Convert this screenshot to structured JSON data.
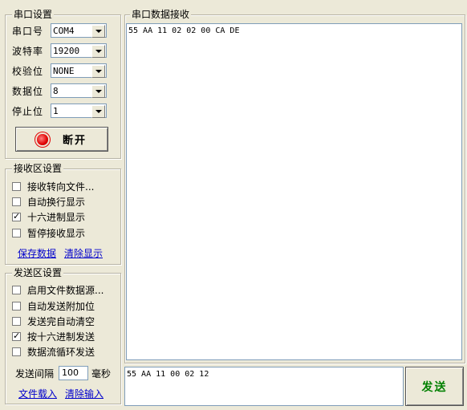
{
  "serial_settings": {
    "title": "串口设置",
    "port_label": "串口号",
    "port_value": "COM4",
    "baud_label": "波特率",
    "baud_value": "19200",
    "parity_label": "校验位",
    "parity_value": "NONE",
    "databits_label": "数据位",
    "databits_value": "8",
    "stopbits_label": "停止位",
    "stopbits_value": "1",
    "connect_button": "断开",
    "status_color": "#E00000"
  },
  "receive_settings": {
    "title": "接收区设置",
    "options": [
      {
        "label": "接收转向文件...",
        "checked": false
      },
      {
        "label": "自动换行显示",
        "checked": false
      },
      {
        "label": "十六进制显示",
        "checked": true
      },
      {
        "label": "暂停接收显示",
        "checked": false
      }
    ],
    "save_link": "保存数据",
    "clear_link": "清除显示"
  },
  "send_settings": {
    "title": "发送区设置",
    "options": [
      {
        "label": "启用文件数据源...",
        "checked": false
      },
      {
        "label": "自动发送附加位",
        "checked": false
      },
      {
        "label": "发送完自动清空",
        "checked": false
      },
      {
        "label": "按十六进制发送",
        "checked": true
      },
      {
        "label": "数据流循环发送",
        "checked": false
      }
    ],
    "interval_label": "发送间隔",
    "interval_value": "100",
    "interval_unit": "毫秒",
    "load_link": "文件载入",
    "clear_link": "清除输入"
  },
  "receive_area": {
    "title": "串口数据接收",
    "content": "55 AA 11 02 02 00 CA DE"
  },
  "send_area": {
    "content": "55 AA 11 00 02 12",
    "send_button": "发送",
    "send_color": "#008000"
  }
}
